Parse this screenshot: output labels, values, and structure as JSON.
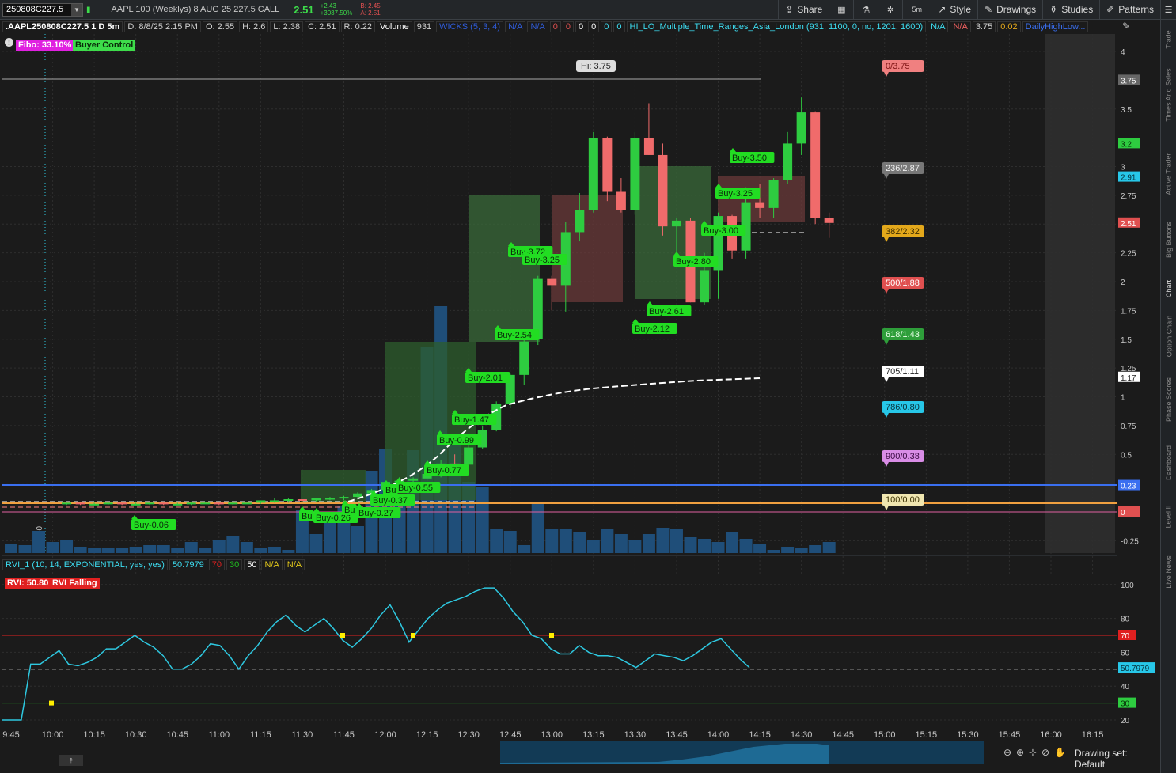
{
  "topbar": {
    "symbol": "250808C227.5",
    "description": "AAPL 100 (Weeklys) 8 AUG 25 227.5 CALL",
    "last": "2.51",
    "change": "+2.43",
    "change_pct": "+3037.50%",
    "bid": "B: 2.45",
    "ask": "A: 2.51",
    "share_label": "Share",
    "timeframe_label": "5m",
    "style_label": "Style",
    "drawings_label": "Drawings",
    "studies_label": "Studies",
    "patterns_label": "Patterns"
  },
  "side_tabs": [
    "Trade",
    "Times And Sales",
    "Active Trader",
    "Big Buttons",
    "Chart",
    "Option Chain",
    "Phase Scores",
    "Dashboard",
    "Level II",
    "Live News"
  ],
  "study_row": {
    "symbol_period": ".AAPL250808C227.5 1 D 5m",
    "date": "D: 8/8/25 2:15 PM",
    "open": "O: 2.55",
    "high": "H: 2.6",
    "low": "L: 2.38",
    "close": "C: 2.51",
    "range": "R: 0.22",
    "volume_label": "Volume",
    "volume_value": "931",
    "wicks": "WICKS (5, 3, 4)",
    "na1": "N/A",
    "na2": "N/A",
    "zeros": [
      "0",
      "0",
      "0",
      "0",
      "0",
      "0"
    ],
    "hilo": "HI_LO_Multiple_Time_Ranges_Asia_London (931, 1100, 0, no, 1201, 1600)",
    "na3": "N/A",
    "na4": "N/A",
    "v375": "3.75",
    "v002": "0.02",
    "daily": "DailyHighLow..."
  },
  "badges": {
    "fibo": "Fibo: 33.10%",
    "buyer": "Buyer Control"
  },
  "price_axis": {
    "ticks": [
      "4",
      "3.5",
      "3",
      "2.75",
      "2.5",
      "2.25",
      "2",
      "1.75",
      "1.5",
      "1.25",
      "1",
      "0.75",
      "0.5",
      "0.25",
      "0",
      "-0.25"
    ],
    "tags": {
      "hi": "3.75",
      "p32": "3.2",
      "p291": "2.91",
      "last": "2.51",
      "p117": "1.17",
      "p023": "0.23",
      "zero": "0"
    }
  },
  "hi_label": "Hi: 3.75",
  "fib_levels": [
    {
      "label": "0/3.75",
      "color": "#f08080",
      "text": "#7a1010"
    },
    {
      "label": "236/2.87",
      "color": "#777777",
      "text": "#eeeeee"
    },
    {
      "label": "382/2.32",
      "color": "#e3a81b",
      "text": "#3a2a00"
    },
    {
      "label": "500/1.88",
      "color": "#e05050",
      "text": "#ffffff"
    },
    {
      "label": "618/1.43",
      "color": "#2e9e3a",
      "text": "#e8ffe8"
    },
    {
      "label": "705/1.11",
      "color": "#ffffff",
      "text": "#222222"
    },
    {
      "label": "786/0.80",
      "color": "#27c7e8",
      "text": "#08313a"
    },
    {
      "label": "900/0.38",
      "color": "#d98de6",
      "text": "#3b0b44"
    },
    {
      "label": "100/0.00",
      "color": "#f0e6b0",
      "text": "#3a3000"
    }
  ],
  "buy_labels": [
    "Buy-0.06",
    "Bu",
    "Buy-0.26",
    "Bu",
    "Buy-0.27",
    "Buy-0.37",
    "Bu",
    "Buy-0.55",
    "Buy-0.77",
    "Buy-0.99",
    "Buy-1.47",
    "Buy-2.01",
    "Buy-2.54",
    "Buy-3.72",
    "Buy-3.25",
    "Buy-2.12",
    "Buy-2.61",
    "Buy-2.80",
    "Buy-3.00",
    "Buy-3.25",
    "Buy-3.50"
  ],
  "time_marker": "10:00",
  "rvi_row": {
    "name": "RVI_1 (10, 14, EXPONENTIAL, yes, yes)",
    "value": "50.7979",
    "v70": "70",
    "v30": "30",
    "v50": "50",
    "na1": "N/A",
    "na2": "N/A"
  },
  "rvi_badges": {
    "rvi": "RVI: 50.80",
    "falling": "RVI Falling"
  },
  "rvi_axis": {
    "ticks": [
      "100",
      "80",
      "60",
      "40",
      "20"
    ],
    "tags": {
      "t70": "70",
      "value": "50.7979",
      "t30": "30"
    }
  },
  "time_axis": [
    "9:45",
    "10:00",
    "10:15",
    "10:30",
    "10:45",
    "11:00",
    "11:15",
    "11:30",
    "11:45",
    "12:00",
    "12:15",
    "12:30",
    "12:45",
    "13:00",
    "13:15",
    "13:30",
    "13:45",
    "14:00",
    "14:15",
    "14:30",
    "14:45",
    "15:00",
    "15:15",
    "15:30",
    "15:45",
    "16:00",
    "16:15"
  ],
  "drawing_set": "Drawing set: Default",
  "colors": {
    "up": "#2ecc40",
    "down": "#f06b6b",
    "volume": "#1f4e79",
    "rvi_line": "#2ec8e0",
    "level_blue": "#3a6ff0",
    "level_orange": "#f0a040",
    "rvi_70": "#e02020",
    "rvi_30": "#20c020"
  }
}
